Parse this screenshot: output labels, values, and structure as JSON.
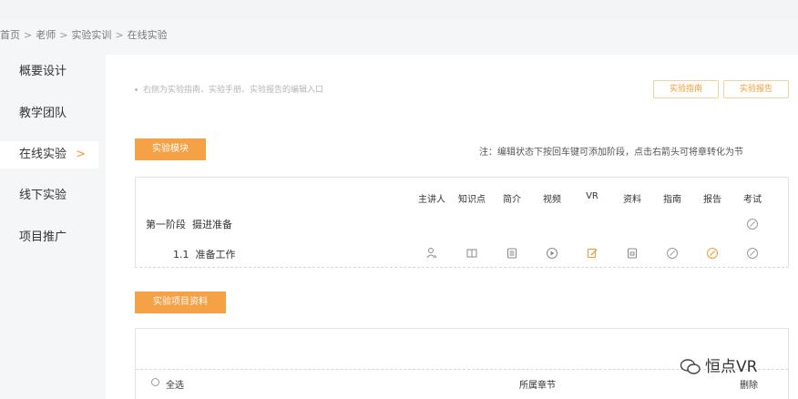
{
  "breadcrumb": [
    "首页",
    "老师",
    "实验实训",
    "在线实验"
  ],
  "breadcrumb_sep": ">",
  "sidebar": {
    "items": [
      {
        "label": "概要设计"
      },
      {
        "label": "教学团队"
      },
      {
        "label": "在线实验",
        "active": true
      },
      {
        "label": "线下实验"
      },
      {
        "label": "项目推广"
      }
    ],
    "active_chevron": ">"
  },
  "header": {
    "hint": "右侧为实验指南、实验手册、实验报告的编辑入口",
    "guide_button": "实验指南",
    "report_button": "实验报告"
  },
  "module": {
    "section_button": "实验模块",
    "note": "注：编辑状态下按回车键可添加阶段，点击右箭头可将章转化为节",
    "columns": [
      "主讲人",
      "知识点",
      "简介",
      "视频",
      "VR",
      "资料",
      "指南",
      "报告",
      "考试"
    ],
    "stage": {
      "label": "第一阶段",
      "title": "摄进准备"
    },
    "section": {
      "number": "1.1",
      "title": "准备工作"
    }
  },
  "resources": {
    "section_button": "实验项目资料",
    "select_all": "全选",
    "chapter_col": "所属章节",
    "delete_col": "删除"
  },
  "watermark": "恒点VR",
  "colors": {
    "accent": "#f5a145",
    "accent_text": "#f39c32"
  }
}
